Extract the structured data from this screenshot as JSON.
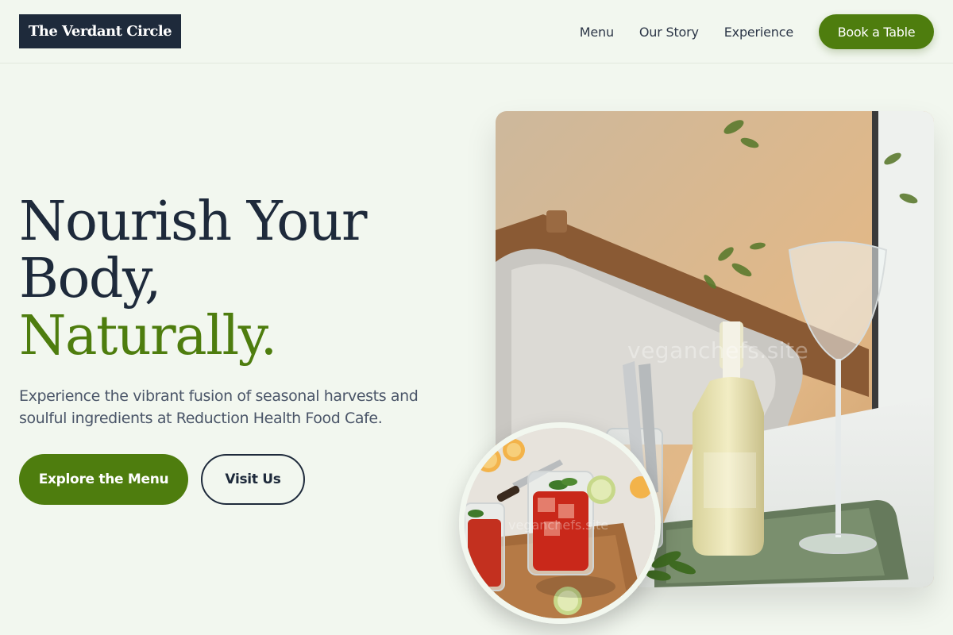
{
  "header": {
    "logo_text": "The Verdant Circle",
    "nav": [
      {
        "label": "Menu"
      },
      {
        "label": "Our Story"
      },
      {
        "label": "Experience"
      }
    ],
    "cta_label": "Book a Table"
  },
  "hero": {
    "title_line1": "Nourish Your",
    "title_line2": "Body,",
    "title_accent": "Naturally.",
    "subtitle": "Experience the vibrant fusion of seasonal harvests and soulful ingredients at Reduction Health Food Cafe.",
    "primary_button": "Explore the Menu",
    "secondary_button": "Visit Us"
  },
  "images": {
    "main_watermark": "veganchefs.site",
    "circle_watermark": "veganchefs.site"
  },
  "colors": {
    "background": "#f2f7ef",
    "navy": "#1e2a3b",
    "accent_green": "#4e7d0e"
  }
}
